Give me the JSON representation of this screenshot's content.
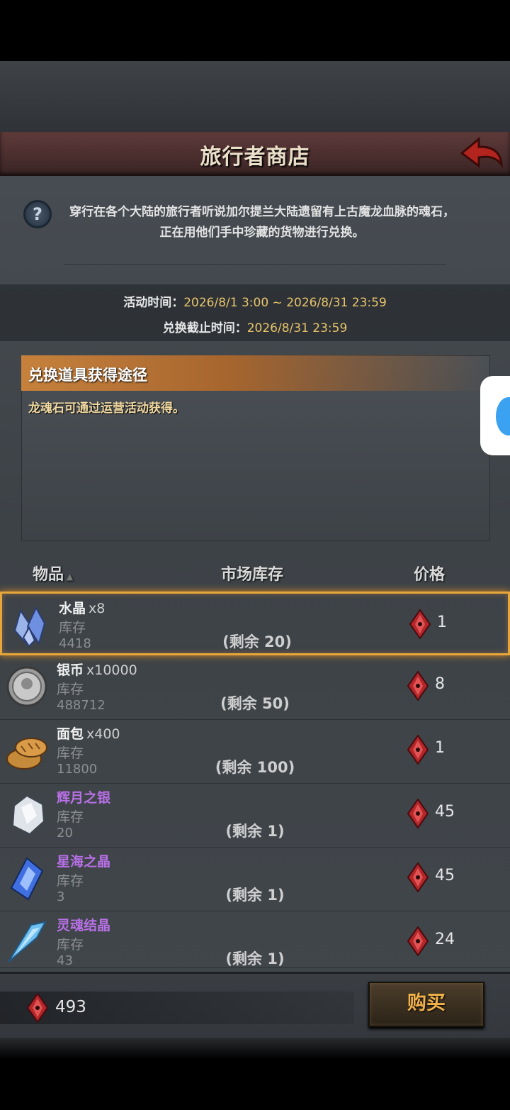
{
  "header": {
    "title": "旅行者商店",
    "back_icon": "back-arrow-icon"
  },
  "description": "穿行在各个大陆的旅行者听说加尔提兰大陆遗留有上古魔龙血脉的魂石，正在用他们手中珍藏的货物进行兑换。",
  "times": {
    "activity_label": "活动时间：",
    "activity_value": "2026/8/1 3:00 ~ 2026/8/31 23:59",
    "deadline_label": "兑换截止时间：",
    "deadline_value": "2026/8/31 23:59"
  },
  "info": {
    "header": "兑换道具获得途径",
    "body": "龙魂石可通过运营活动获得。"
  },
  "columns": {
    "item": "物品",
    "stock": "市场库存",
    "price": "价格"
  },
  "stock_label": "库存",
  "items": [
    {
      "name": "水晶",
      "qty": "x8",
      "stock": "4418",
      "remaining": "(剩余 20)",
      "price": "1",
      "color": "#f1f1f1",
      "icon": "crystal-icon"
    },
    {
      "name": "银币",
      "qty": "x10000",
      "stock": "488712",
      "remaining": "(剩余 50)",
      "price": "8",
      "color": "#f1f1f1",
      "icon": "silver-coin-icon"
    },
    {
      "name": "面包",
      "qty": "x400",
      "stock": "11800",
      "remaining": "(剩余 100)",
      "price": "1",
      "color": "#f1f1f1",
      "icon": "bread-icon"
    },
    {
      "name": "辉月之银",
      "qty": "",
      "stock": "20",
      "remaining": "(剩余 1)",
      "price": "45",
      "color": "#b870e6",
      "icon": "moon-silver-icon"
    },
    {
      "name": "星海之晶",
      "qty": "",
      "stock": "3",
      "remaining": "(剩余 1)",
      "price": "45",
      "color": "#b870e6",
      "icon": "star-crystal-icon"
    },
    {
      "name": "灵魂结晶",
      "qty": "",
      "stock": "43",
      "remaining": "(剩余 1)",
      "price": "24",
      "color": "#b870e6",
      "icon": "soul-crystal-icon"
    }
  ],
  "footer": {
    "balance": "493",
    "buy_label": "购买"
  }
}
